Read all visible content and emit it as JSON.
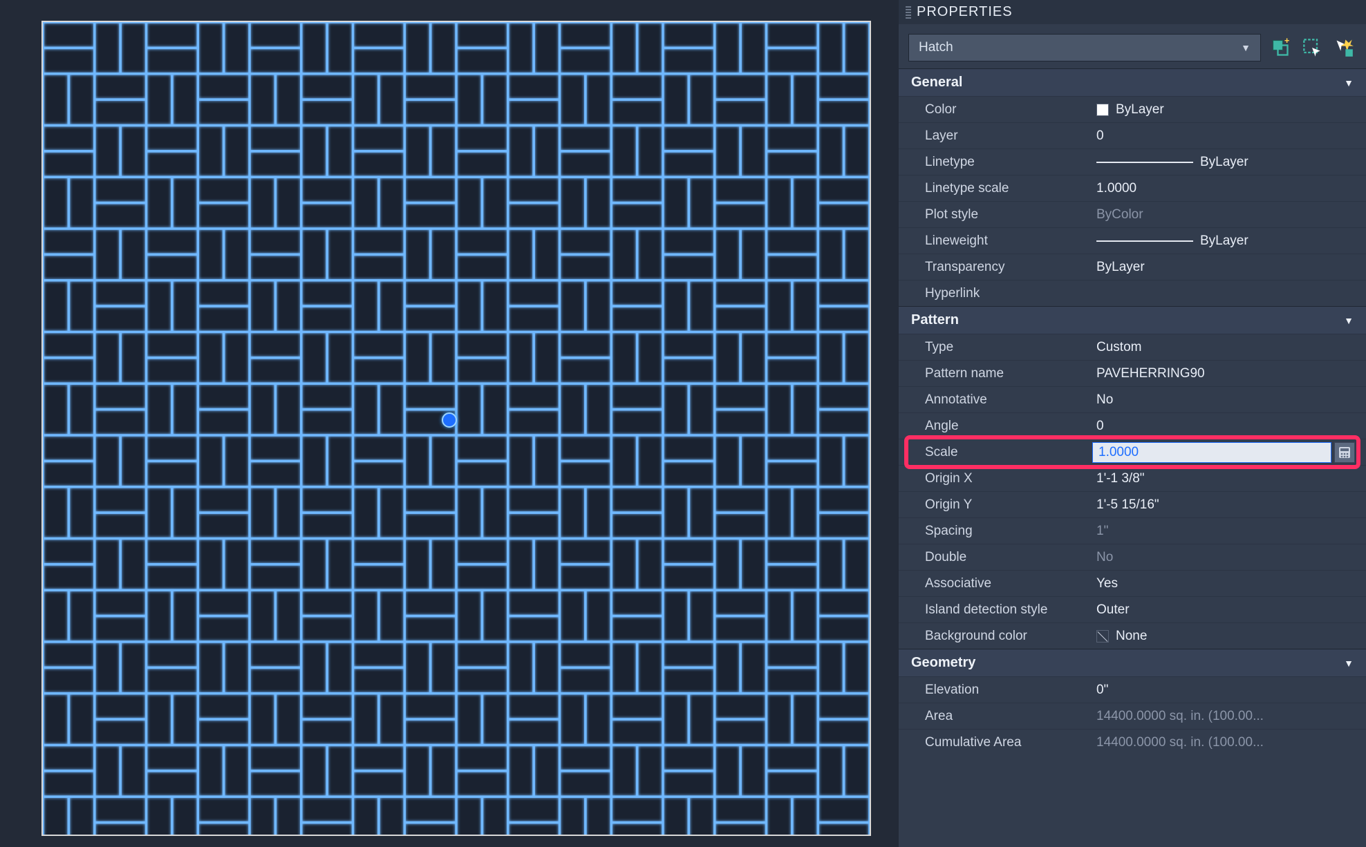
{
  "panel": {
    "title": "PROPERTIES",
    "object_type": "Hatch",
    "icons": {
      "pickadd": "pickadd-icon",
      "quickselect": "quickselect-icon",
      "quickprops": "quickprops-icon"
    }
  },
  "sections": {
    "general": {
      "title": "General",
      "color_label": "Color",
      "color_value": "ByLayer",
      "layer_label": "Layer",
      "layer_value": "0",
      "linetype_label": "Linetype",
      "linetype_value": "ByLayer",
      "ltscale_label": "Linetype scale",
      "ltscale_value": "1.0000",
      "plotstyle_label": "Plot style",
      "plotstyle_value": "ByColor",
      "lineweight_label": "Lineweight",
      "lineweight_value": "ByLayer",
      "transparency_label": "Transparency",
      "transparency_value": "ByLayer",
      "hyperlink_label": "Hyperlink",
      "hyperlink_value": ""
    },
    "pattern": {
      "title": "Pattern",
      "type_label": "Type",
      "type_value": "Custom",
      "name_label": "Pattern name",
      "name_value": "PAVEHERRING90",
      "annotative_label": "Annotative",
      "annotative_value": "No",
      "angle_label": "Angle",
      "angle_value": "0",
      "scale_label": "Scale",
      "scale_value": "1.0000",
      "originx_label": "Origin X",
      "originx_value": "1'-1 3/8\"",
      "originy_label": "Origin Y",
      "originy_value": "1'-5 15/16\"",
      "spacing_label": "Spacing",
      "spacing_value": "1\"",
      "double_label": "Double",
      "double_value": "No",
      "assoc_label": "Associative",
      "assoc_value": "Yes",
      "island_label": "Island detection style",
      "island_value": "Outer",
      "bg_label": "Background color",
      "bg_value": "None"
    },
    "geometry": {
      "title": "Geometry",
      "elev_label": "Elevation",
      "elev_value": "0\"",
      "area_label": "Area",
      "area_value": "14400.0000 sq. in. (100.00...",
      "cum_label": "Cumulative Area",
      "cum_value": "14400.0000 sq. in. (100.00..."
    }
  }
}
